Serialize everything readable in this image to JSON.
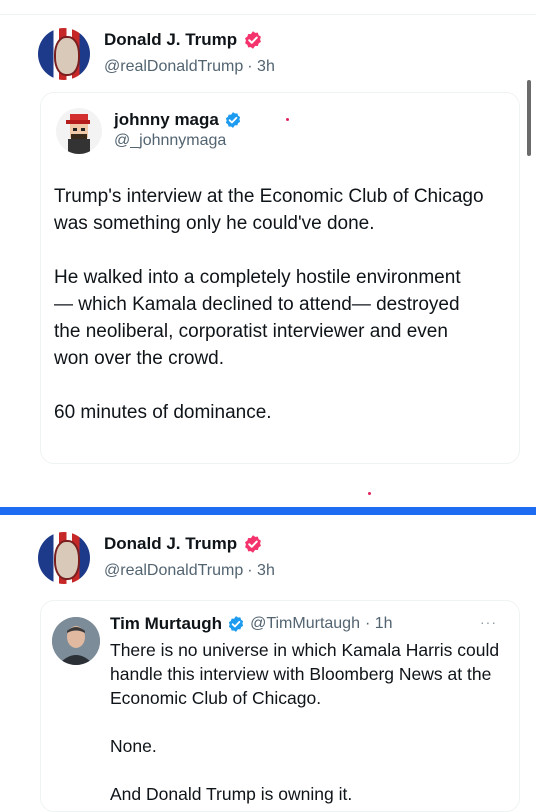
{
  "post1": {
    "author_name": "Donald J. Trump",
    "author_handle": "@realDonaldTrump",
    "time": "· 3h",
    "quoted": {
      "name": "johnny maga",
      "handle": "@_johnnymaga",
      "text": "Trump's interview at the Economic Club of Chicago\nwas something only he could've done.\n\nHe walked into a completely hostile environment\n— which Kamala declined to attend— destroyed\nthe neoliberal, corporatist interviewer and even\nwon over the crowd.\n\n60 minutes of dominance."
    }
  },
  "post2": {
    "author_name": "Donald J. Trump",
    "author_handle": "@realDonaldTrump",
    "time": "· 3h",
    "quoted": {
      "name": "Tim Murtaugh",
      "handle": "@TimMurtaugh",
      "time": "· 1h",
      "more": "···",
      "text": "There is no universe in which Kamala Harris could\nhandle this interview with Bloomberg News at the\nEconomic Club of Chicago.\n\nNone.\n\nAnd Donald Trump is owning it."
    }
  },
  "colors": {
    "verified_pink": "#f4336d",
    "verified_blue": "#1d9bf0",
    "divider_blue": "#1d6cf2",
    "handle_gray": "#536471"
  },
  "icons": [
    "verified-badge-icon",
    "more-options-icon"
  ]
}
